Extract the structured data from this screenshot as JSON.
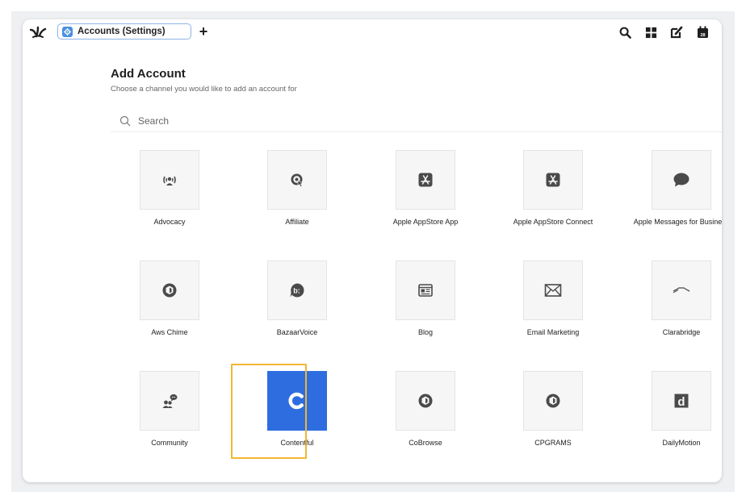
{
  "topbar": {
    "tab_label": "Accounts (Settings)",
    "new_tab_symbol": "+",
    "logo_icon": "sprinklr-logo",
    "tools": [
      "search-icon",
      "grid-icon",
      "compose-icon",
      "calendar-icon"
    ],
    "calendar_day": "28"
  },
  "page": {
    "title": "Add Account",
    "subtitle": "Choose a channel you would like to add an account for",
    "search_placeholder": "Search"
  },
  "channels": [
    {
      "label": "Advocacy",
      "icon": "advocacy-icon"
    },
    {
      "label": "Affiliate",
      "icon": "affiliate-icon"
    },
    {
      "label": "Apple AppStore App",
      "icon": "appstore-icon"
    },
    {
      "label": "Apple AppStore Connect",
      "icon": "appstore-icon"
    },
    {
      "label": "Apple Messages for Business",
      "icon": "chat-bubble-icon"
    },
    {
      "label": "Aws Chime",
      "icon": "hexagon-box-icon"
    },
    {
      "label": "BazaarVoice",
      "icon": "bazaarvoice-icon"
    },
    {
      "label": "Blog",
      "icon": "blog-icon"
    },
    {
      "label": "Email Marketing",
      "icon": "envelope-icon"
    },
    {
      "label": "Clarabridge",
      "icon": "clarabridge-icon"
    },
    {
      "label": "Community",
      "icon": "community-icon"
    },
    {
      "label": "Contentful",
      "icon": "contentful-icon",
      "selected": true
    },
    {
      "label": "CoBrowse",
      "icon": "hexagon-box-icon"
    },
    {
      "label": "CPGRAMS",
      "icon": "hexagon-box-icon"
    },
    {
      "label": "DailyMotion",
      "icon": "dailymotion-icon"
    }
  ],
  "colors": {
    "selected_tile": "#2d6de0",
    "selected_outline": "#f2b632",
    "tab_border": "#8fb4e6",
    "icon_gray": "#4a4a4a"
  }
}
